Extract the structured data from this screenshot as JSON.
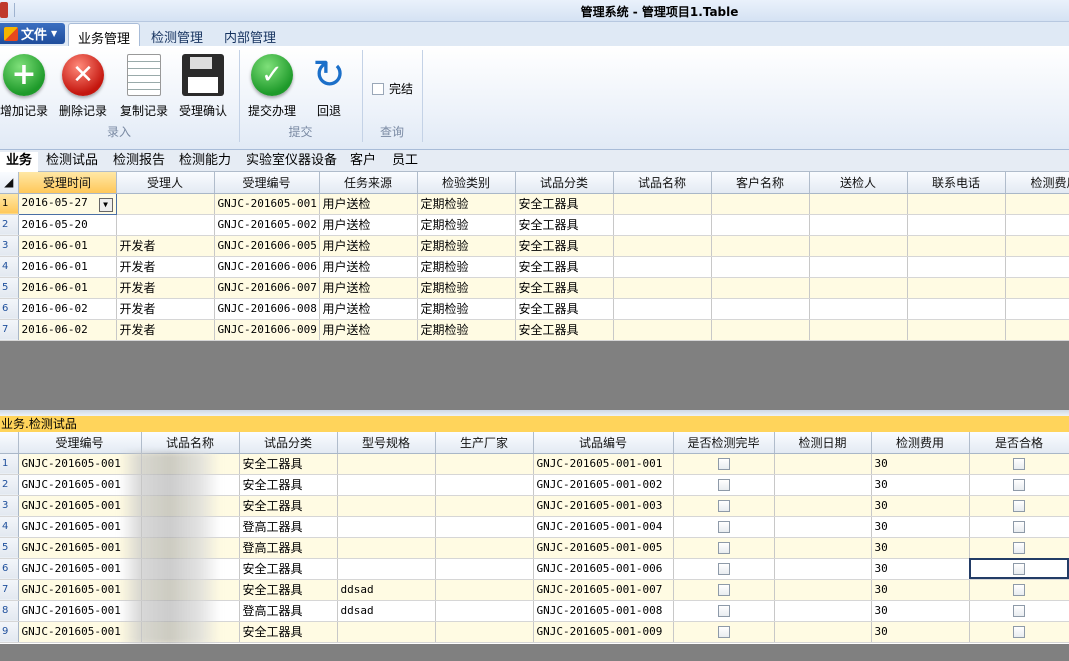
{
  "window": {
    "title": "管理系统 - 管理项目1.Table"
  },
  "ribbon": {
    "file_label": "文件",
    "tabs": [
      "业务管理",
      "检测管理",
      "内部管理"
    ],
    "groups": {
      "entry": {
        "label": "录入",
        "buttons": [
          "增加记录",
          "删除记录",
          "复制记录",
          "受理确认"
        ]
      },
      "submit": {
        "label": "提交",
        "buttons": [
          "提交办理",
          "回退"
        ]
      },
      "query": {
        "label": "查询",
        "checkbox": "完结"
      }
    }
  },
  "subtabs": [
    "业务",
    "检测试品",
    "检测报告",
    "检测能力",
    "实验室仪器设备",
    "客户",
    "员工"
  ],
  "top_grid": {
    "columns": [
      "受理时间",
      "受理人",
      "受理编号",
      "任务来源",
      "检验类别",
      "试品分类",
      "试品名称",
      "客户名称",
      "送检人",
      "联系电话",
      "检测费用"
    ],
    "rows": [
      [
        "1",
        "2016-05-27",
        "",
        "GNJC-201605-001",
        "用户送检",
        "定期检验",
        "安全工器具",
        "",
        "",
        "",
        "",
        ""
      ],
      [
        "2",
        "2016-05-20",
        "",
        "GNJC-201605-002",
        "用户送检",
        "定期检验",
        "安全工器具",
        "",
        "",
        "",
        "",
        ""
      ],
      [
        "3",
        "2016-06-01",
        "开发者",
        "GNJC-201606-005",
        "用户送检",
        "定期检验",
        "安全工器具",
        "",
        "",
        "",
        "",
        ""
      ],
      [
        "4",
        "2016-06-01",
        "开发者",
        "GNJC-201606-006",
        "用户送检",
        "定期检验",
        "安全工器具",
        "",
        "",
        "",
        "",
        ""
      ],
      [
        "5",
        "2016-06-01",
        "开发者",
        "GNJC-201606-007",
        "用户送检",
        "定期检验",
        "安全工器具",
        "",
        "",
        "",
        "",
        ""
      ],
      [
        "6",
        "2016-06-02",
        "开发者",
        "GNJC-201606-008",
        "用户送检",
        "定期检验",
        "安全工器具",
        "",
        "",
        "",
        "",
        ""
      ],
      [
        "7",
        "2016-06-02",
        "开发者",
        "GNJC-201606-009",
        "用户送检",
        "定期检验",
        "安全工器具",
        "",
        "",
        "",
        "",
        ""
      ]
    ]
  },
  "section_label": "业务.检测试品",
  "bottom_grid": {
    "columns": [
      "受理编号",
      "试品名称",
      "试品分类",
      "型号规格",
      "生产厂家",
      "试品编号",
      "是否检测完毕",
      "检测日期",
      "检测费用",
      "是否合格"
    ],
    "rows": [
      [
        "1",
        "GNJC-201605-001",
        "",
        "安全工器具",
        "",
        "",
        "GNJC-201605-001-001",
        "",
        "",
        "30",
        ""
      ],
      [
        "2",
        "GNJC-201605-001",
        "",
        "安全工器具",
        "",
        "",
        "GNJC-201605-001-002",
        "",
        "",
        "30",
        ""
      ],
      [
        "3",
        "GNJC-201605-001",
        "",
        "安全工器具",
        "",
        "",
        "GNJC-201605-001-003",
        "",
        "",
        "30",
        ""
      ],
      [
        "4",
        "GNJC-201605-001",
        "",
        "登高工器具",
        "",
        "",
        "GNJC-201605-001-004",
        "",
        "",
        "30",
        ""
      ],
      [
        "5",
        "GNJC-201605-001",
        "",
        "登高工器具",
        "",
        "",
        "GNJC-201605-001-005",
        "",
        "",
        "30",
        ""
      ],
      [
        "6",
        "GNJC-201605-001",
        "",
        "安全工器具",
        "",
        "",
        "GNJC-201605-001-006",
        "",
        "",
        "30",
        ""
      ],
      [
        "7",
        "GNJC-201605-001",
        "",
        "安全工器具",
        "ddsad",
        "",
        "GNJC-201605-001-007",
        "",
        "",
        "30",
        ""
      ],
      [
        "8",
        "GNJC-201605-001",
        "",
        "登高工器具",
        "ddsad",
        "",
        "GNJC-201605-001-008",
        "",
        "",
        "30",
        ""
      ],
      [
        "9",
        "GNJC-201605-001",
        "",
        "安全工器具",
        "",
        "",
        "GNJC-201605-001-009",
        "",
        "",
        "30",
        ""
      ]
    ]
  }
}
